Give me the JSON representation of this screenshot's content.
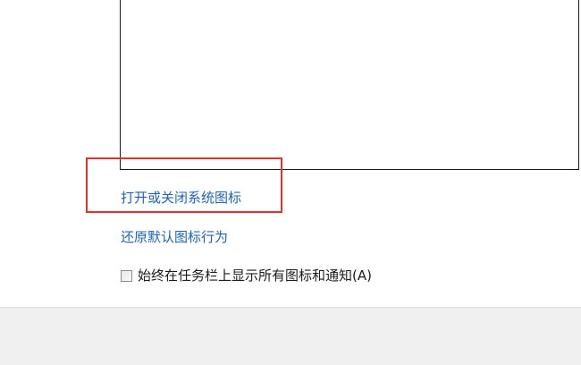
{
  "links": {
    "system_icons": "打开或关闭系统图标",
    "restore_defaults": "还原默认图标行为"
  },
  "checkbox": {
    "label": "始终在任务栏上显示所有图标和通知(A)",
    "checked": false
  },
  "colors": {
    "link": "#1d64b6",
    "highlight": "#e4322b",
    "bottom_bar": "#f0f0f0"
  }
}
